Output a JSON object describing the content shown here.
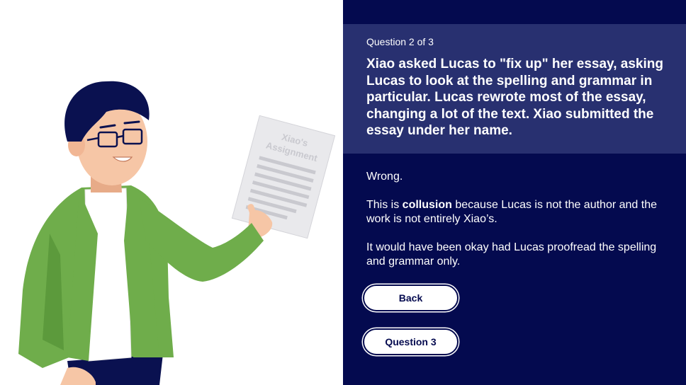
{
  "illustration": {
    "paper_title_line1": "Xiao's",
    "paper_title_line2": "Assignment"
  },
  "question": {
    "counter": "Question 2 of 3",
    "text": "Xiao asked Lucas to \"fix up\" her essay, asking Lucas to look at the spelling and grammar in particular. Lucas rewrote most of the essay, changing a lot of the text. Xiao submitted the essay under her name."
  },
  "feedback": {
    "verdict": "Wrong.",
    "explanation_prefix": "This is ",
    "explanation_term": "collusion",
    "explanation_suffix": " because Lucas is not the author and the work is not entirely Xiao’s.",
    "note": "It would have been okay had Lucas proofread the spelling and grammar only."
  },
  "buttons": {
    "back_label": "Back",
    "next_label": "Question 3"
  },
  "colors": {
    "panel_bg": "#040a4f",
    "question_box_bg": "#283070",
    "jacket_green": "#6fad4b",
    "hair": "#0a1150",
    "skin": "#f6c6a6"
  }
}
